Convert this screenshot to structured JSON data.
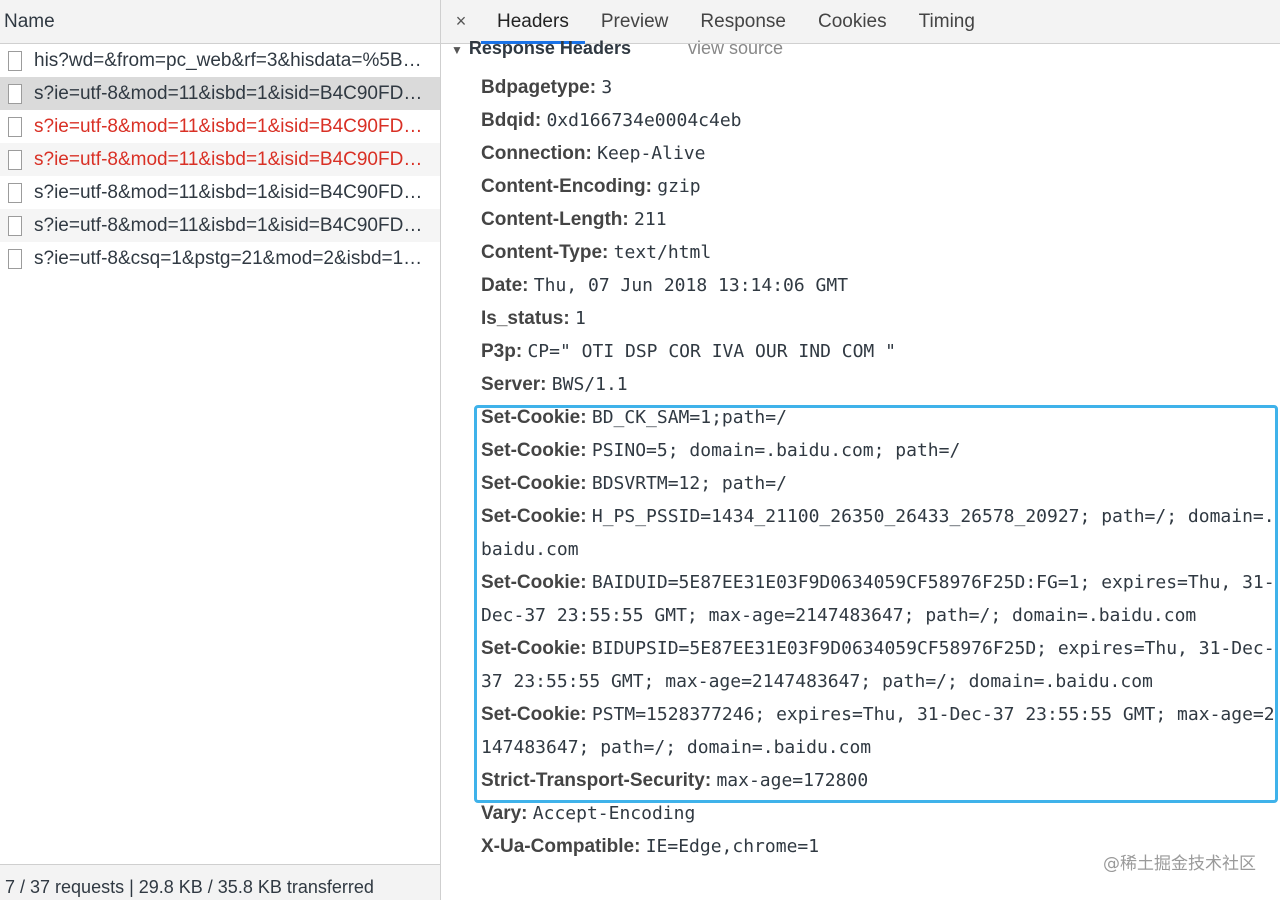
{
  "left": {
    "header": "Name",
    "requests": [
      {
        "name": "his?wd=&from=pc_web&rf=3&hisdata=%5B…",
        "state": "normal"
      },
      {
        "name": "s?ie=utf-8&mod=11&isbd=1&isid=B4C90FD…",
        "state": "selected"
      },
      {
        "name": "s?ie=utf-8&mod=11&isbd=1&isid=B4C90FD…",
        "state": "error"
      },
      {
        "name": "s?ie=utf-8&mod=11&isbd=1&isid=B4C90FD…",
        "state": "error"
      },
      {
        "name": "s?ie=utf-8&mod=11&isbd=1&isid=B4C90FD…",
        "state": "normal"
      },
      {
        "name": "s?ie=utf-8&mod=11&isbd=1&isid=B4C90FD…",
        "state": "normal"
      },
      {
        "name": "s?ie=utf-8&csq=1&pstg=21&mod=2&isbd=1…",
        "state": "normal"
      }
    ],
    "footer": "7 / 37 requests | 29.8 KB / 35.8 KB transferred"
  },
  "tabs": {
    "close": "×",
    "items": [
      "Headers",
      "Preview",
      "Response",
      "Cookies",
      "Timing"
    ],
    "active": "Headers"
  },
  "response_headers": {
    "title": "Response Headers",
    "view_source": "view source",
    "items": [
      {
        "name": "Bdpagetype:",
        "value": "3"
      },
      {
        "name": "Bdqid:",
        "value": "0xd166734e0004c4eb"
      },
      {
        "name": "Connection:",
        "value": "Keep-Alive"
      },
      {
        "name": "Content-Encoding:",
        "value": "gzip"
      },
      {
        "name": "Content-Length:",
        "value": "211"
      },
      {
        "name": "Content-Type:",
        "value": "text/html"
      },
      {
        "name": "Date:",
        "value": "Thu, 07 Jun 2018 13:14:06 GMT"
      },
      {
        "name": "Is_status:",
        "value": "1"
      },
      {
        "name": "P3p:",
        "value": "CP=\" OTI DSP COR IVA OUR IND COM \""
      },
      {
        "name": "Server:",
        "value": "BWS/1.1"
      },
      {
        "name": "Set-Cookie:",
        "value": "BD_CK_SAM=1;path=/"
      },
      {
        "name": "Set-Cookie:",
        "value": "PSINO=5; domain=.baidu.com; path=/"
      },
      {
        "name": "Set-Cookie:",
        "value": "BDSVRTM=12; path=/"
      },
      {
        "name": "Set-Cookie:",
        "value": "H_PS_PSSID=1434_21100_26350_26433_26578_20927; path=/; domain=.baidu.com"
      },
      {
        "name": "Set-Cookie:",
        "value": "BAIDUID=5E87EE31E03F9D0634059CF58976F25D:FG=1; expires=Thu, 31-Dec-37 23:55:55 GMT; max-age=2147483647; path=/; domain=.baidu.com"
      },
      {
        "name": "Set-Cookie:",
        "value": "BIDUPSID=5E87EE31E03F9D0634059CF58976F25D; expires=Thu, 31-Dec-37 23:55:55 GMT; max-age=2147483647; path=/; domain=.baidu.com"
      },
      {
        "name": "Set-Cookie:",
        "value": "PSTM=1528377246; expires=Thu, 31-Dec-37 23:55:55 GMT; max-age=2147483647; path=/; domain=.baidu.com"
      },
      {
        "name": "Strict-Transport-Security:",
        "value": "max-age=172800"
      },
      {
        "name": "Vary:",
        "value": "Accept-Encoding"
      },
      {
        "name": "X-Ua-Compatible:",
        "value": "IE=Edge,chrome=1"
      }
    ]
  },
  "watermark": "@稀土掘金技术社区",
  "colors": {
    "highlight": "#3fb2ea",
    "error": "#d93025",
    "active_tab": "#1a73e8"
  }
}
